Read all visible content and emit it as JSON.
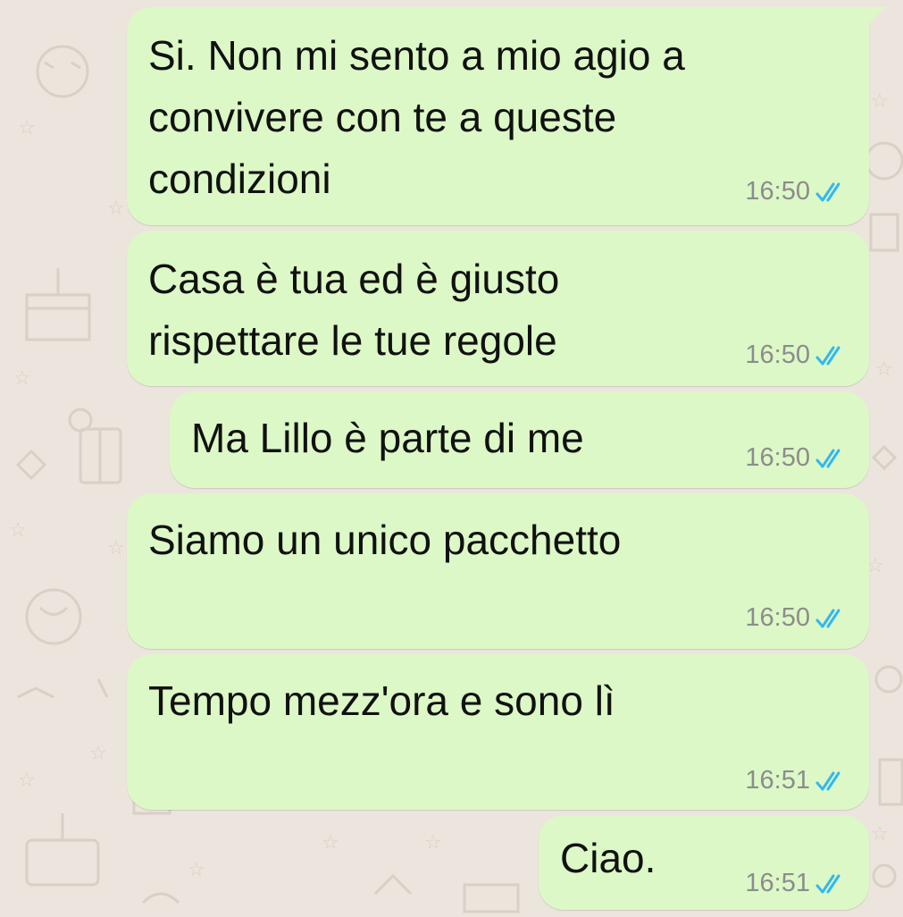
{
  "messages": [
    {
      "text": "Si. Non mi sento a mio agio a convivere con te a queste condizioni",
      "time": "16:50",
      "status_icon": "double-check-read-icon"
    },
    {
      "text": "Casa è tua ed è giusto rispettare le tue regole",
      "time": "16:50",
      "status_icon": "double-check-read-icon"
    },
    {
      "text": "Ma Lillo è parte di me",
      "time": "16:50",
      "status_icon": "double-check-read-icon"
    },
    {
      "text": "Siamo un unico pacchetto",
      "time": "16:50",
      "status_icon": "double-check-read-icon"
    },
    {
      "text": "Tempo mezz'ora e sono lì",
      "time": "16:51",
      "status_icon": "double-check-read-icon"
    },
    {
      "text": "Ciao.",
      "time": "16:51",
      "status_icon": "double-check-read-icon"
    }
  ],
  "colors": {
    "background": "#ece5dd",
    "outgoing_bubble": "#dcf8c6",
    "read_ticks": "#34b7f1",
    "timestamp": "#8c8c8c"
  }
}
